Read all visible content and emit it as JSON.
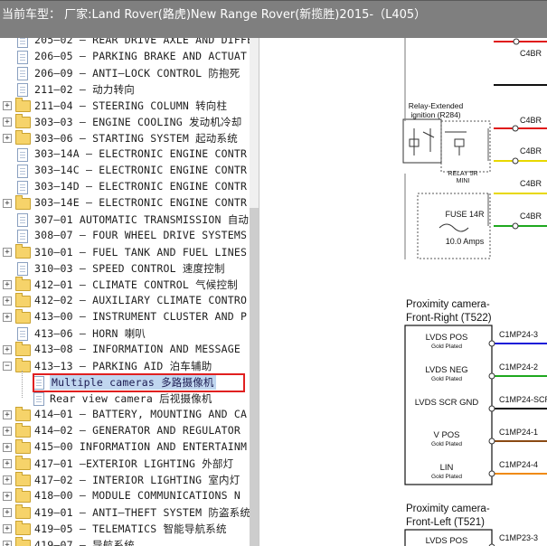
{
  "window": {
    "title": "当前车型： 厂家:Land Rover(路虎)New Range Rover(新揽胜)2015-（L405）"
  },
  "tree": {
    "items": [
      {
        "label": "205—02 — REAR DRIVE AXLE AND DIFFE",
        "icon": "document-icon"
      },
      {
        "label": "206—05 — PARKING BRAKE AND ACTUAT",
        "icon": "document-icon"
      },
      {
        "label": "206—09 — ANTI—LOCK CONTROL 防抱死",
        "icon": "document-icon"
      },
      {
        "label": "211—02 — 动力转向",
        "icon": "document-icon"
      },
      {
        "label": "211—04 — STEERING COLUMN 转向柱",
        "icon": "folder-icon"
      },
      {
        "label": "303—03 — ENGINE COOLING 发动机冷却",
        "icon": "folder-icon"
      },
      {
        "label": "303—06 — STARTING SYSTEM 起动系统",
        "icon": "folder-icon"
      },
      {
        "label": "303—14A — ELECTRONIC ENGINE CONTR",
        "icon": "document-icon"
      },
      {
        "label": "303—14C — ELECTRONIC ENGINE CONTR",
        "icon": "document-icon"
      },
      {
        "label": "303—14D — ELECTRONIC ENGINE CONTR",
        "icon": "document-icon"
      },
      {
        "label": "303—14E — ELECTRONIC ENGINE CONTR",
        "icon": "folder-icon"
      },
      {
        "label": "307—01 AUTOMATIC TRANSMISSION 自动",
        "icon": "document-icon"
      },
      {
        "label": "308—07 — FOUR WHEEL DRIVE SYSTEMS",
        "icon": "document-icon"
      },
      {
        "label": "310—01 — FUEL TANK AND FUEL LINES 油",
        "icon": "folder-icon"
      },
      {
        "label": "310—03 — SPEED CONTROL 速度控制",
        "icon": "document-icon"
      },
      {
        "label": "412—01 — CLIMATE CONTROL 气候控制",
        "icon": "folder-icon"
      },
      {
        "label": "412—02 — AUXILIARY CLIMATE CONTRO",
        "icon": "folder-icon"
      },
      {
        "label": "413—00 — INSTRUMENT CLUSTER AND P",
        "icon": "folder-icon"
      },
      {
        "label": "413—06 — HORN 喇叭",
        "icon": "document-icon"
      },
      {
        "label": "413—08 — INFORMATION AND MESSAGE",
        "icon": "folder-icon"
      },
      {
        "label": "413—13 — PARKING AID 泊车辅助",
        "icon": "folder-open-icon"
      },
      {
        "label": "Multiple cameras 多路摄像机",
        "icon": "document-icon"
      },
      {
        "label": "Rear view camera 后视摄像机",
        "icon": "document-icon"
      },
      {
        "label": "414—01 — BATTERY, MOUNTING AND CA",
        "icon": "folder-icon"
      },
      {
        "label": "414—02 — GENERATOR AND REGULATOR",
        "icon": "folder-icon"
      },
      {
        "label": "415—00 INFORMATION AND ENTERTAINM",
        "icon": "folder-icon"
      },
      {
        "label": "417—01 —EXTERIOR LIGHTING 外部灯",
        "icon": "folder-icon"
      },
      {
        "label": "417—02 — INTERIOR LIGHTING 室内灯",
        "icon": "folder-icon"
      },
      {
        "label": "418—00 — MODULE COMMUNICATIONS N",
        "icon": "folder-icon"
      },
      {
        "label": "419—01 — ANTI—THEFT SYSTEM 防盗系统",
        "icon": "folder-icon"
      },
      {
        "label": "419—05 — TELEMATICS 智能导航系统",
        "icon": "folder-icon"
      },
      {
        "label": "419—07 — 导航系统",
        "icon": "folder-icon"
      }
    ],
    "selected_index": 21
  },
  "diagram": {
    "relay_title_line1": "Relay-Extended",
    "relay_title_line2": "ignition (R284)",
    "relay_name": "RELAY 5R",
    "relay_size": "MINI",
    "fuse_name": "FUSE 14R",
    "fuse_rating": "10.0 Amps",
    "connectors_top": [
      "C4BR",
      "C4BR",
      "C4BR",
      "C4BR",
      "C4BR"
    ],
    "camera_right_title_line1": "Proximity camera-",
    "camera_right_title_line2": "Front-Right (T522)",
    "camera_left_title_line1": "Proximity camera-",
    "camera_left_title_line2": "Front-Left (T521)",
    "pins_right": [
      {
        "name": "LVDS POS",
        "sub": "Gold Plated",
        "conn": "C1MP24-3",
        "color": "#1a1ad8"
      },
      {
        "name": "LVDS NEG",
        "sub": "Gold Plated",
        "conn": "C1MP24-2",
        "color": "#1fa81f"
      },
      {
        "name": "LVDS SCR GND",
        "sub": "",
        "conn": "C1MP24-SCR",
        "color": "#111111"
      },
      {
        "name": "V POS",
        "sub": "Gold Plated",
        "conn": "C1MP24-1",
        "color": "#8a4a14"
      },
      {
        "name": "LIN",
        "sub": "Gold Plated",
        "conn": "C1MP24-4",
        "color": "#f08a10"
      }
    ],
    "pins_left": [
      {
        "name": "LVDS POS",
        "sub": "",
        "conn": "C1MP23-3",
        "color": "#1a1ad8"
      }
    ]
  },
  "colors": {
    "wire_red": "#e01818",
    "wire_green": "#1fa81f",
    "wire_yellow": "#e8d800",
    "wire_black": "#111111",
    "selection_border": "#e02020"
  }
}
